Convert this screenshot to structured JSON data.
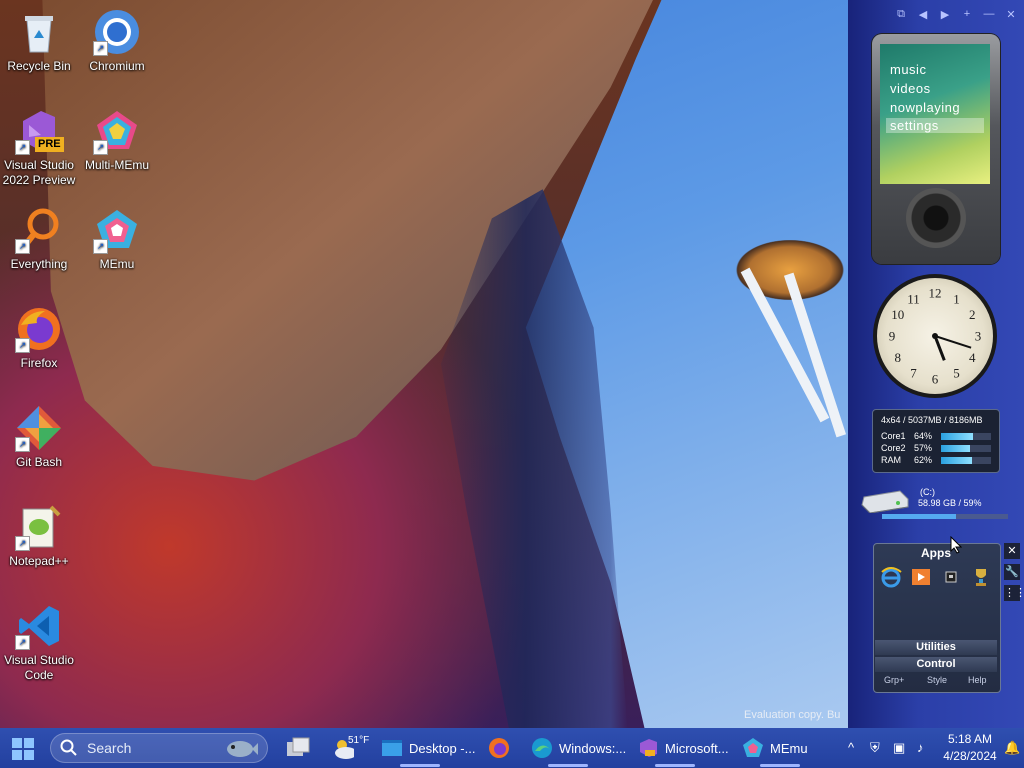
{
  "desktop": {
    "icons": [
      {
        "label": "Recycle Bin"
      },
      {
        "label": "Chromium"
      },
      {
        "label": "Visual Studio 2022 Preview",
        "badge": "PRE"
      },
      {
        "label": "Multi-MEmu"
      },
      {
        "label": "Everything"
      },
      {
        "label": "MEmu"
      },
      {
        "label": "Firefox"
      },
      {
        "label": "Git Bash"
      },
      {
        "label": "Notepad++"
      },
      {
        "label": "Visual Studio Code"
      }
    ],
    "watermark": "Evaluation copy. Bu"
  },
  "sidebar": {
    "zune": {
      "menu": [
        "music",
        "videos",
        "nowplaying",
        "settings"
      ],
      "selected_index": 3
    },
    "clock": {
      "hour": 5,
      "minute": 18
    },
    "cpu_meter": {
      "header": "4x64 / 5037MB / 8186MB",
      "rows": [
        {
          "label": "Core1",
          "percent_text": "64%",
          "value": 64
        },
        {
          "label": "Core2",
          "percent_text": "57%",
          "value": 57
        },
        {
          "label": "RAM",
          "percent_text": "62%",
          "value": 62
        }
      ]
    },
    "drive": {
      "label": "(C:)",
      "usage": "58.98 GB / 59%",
      "value": 59
    },
    "apps": {
      "title": "Apps",
      "groups": [
        "Utilities",
        "Control"
      ],
      "footer": [
        "Grp+",
        "Style",
        "Help"
      ]
    }
  },
  "taskbar": {
    "search_placeholder": "Search",
    "weather": "51°F",
    "items": [
      {
        "label": "Desktop -..."
      },
      {
        "label": "Windows:..."
      },
      {
        "label": "Microsoft..."
      },
      {
        "label": "MEmu"
      }
    ],
    "time": "5:18 AM",
    "date": "4/28/2024"
  },
  "colors": {
    "sidebar": "#2b3fa8",
    "taskbar": "#2a47a8",
    "accent": "#55aaf0"
  }
}
